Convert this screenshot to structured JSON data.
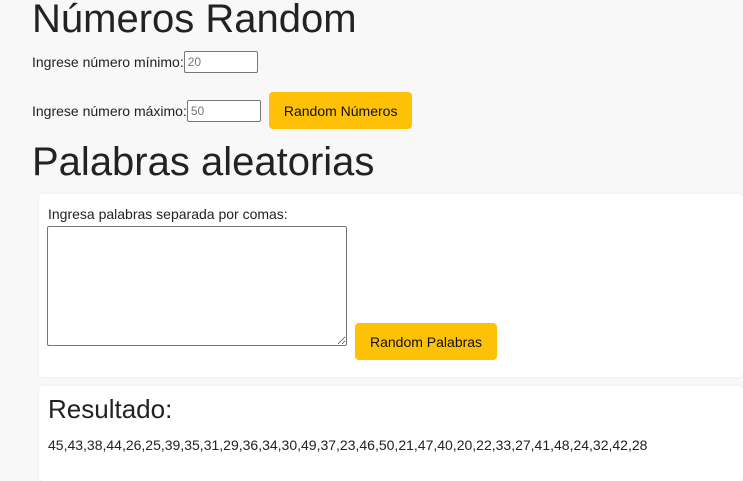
{
  "numbers": {
    "title": "Números Random",
    "min_label": "Ingrese número mínimo:",
    "min_placeholder": "20",
    "max_label": "Ingrese número máximo:",
    "max_placeholder": "50",
    "button_label": "Random Números"
  },
  "words": {
    "title": "Palabras aleatorias",
    "input_label": "Ingresa palabras separada por comas:",
    "textarea_value": "",
    "button_label": "Random Palabras"
  },
  "result": {
    "title": "Resultado:",
    "values": "45,43,38,44,26,25,39,35,31,29,36,34,30,49,37,23,46,50,21,47,40,20,22,33,27,41,48,24,32,42,28"
  },
  "colors": {
    "page_background": "#f8f8f8",
    "card_background": "#ffffff",
    "button_accent": "#ffc107"
  }
}
